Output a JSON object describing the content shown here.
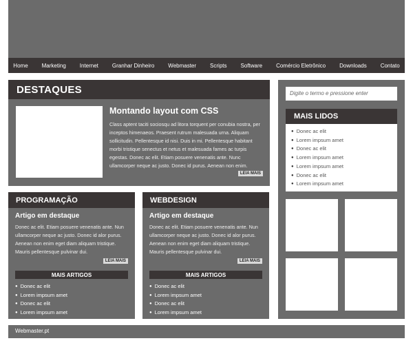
{
  "nav": [
    "Home",
    "Marketing",
    "Internet",
    "Granhar Dinheiro",
    "Webmaster",
    "Scripts",
    "Software",
    "Comércio Eletrônico",
    "Downloads",
    "Contato"
  ],
  "destaques": {
    "heading": "DESTAQUES",
    "title": "Montando layout com CSS",
    "text": "Class aptent taciti sociosqu ad litora torquent per conubia nostra, per inceptos himenaeos. Praesent rutrum malesuada urna. Aliquam sollicitudin. Pellentesque id nisi. Duis in mi. Pellentesque habitant morbi tristique senectus et netus et malesuada fames ac turpis egestas. Donec ac elit. Etiam posuere venenatis ante. Nunc ullamcorper neque ac justo. Donec id purus. Aenean non enim.",
    "button": "LEIA MAIS"
  },
  "programacao": {
    "heading": "PROGRAMAÇÃO",
    "subtitle": "Artigo em destaque",
    "text": "Donec ac elit. Etiam posuere venenatis ante. Nun ullamcorper neque ac justo. Donec id alor purus. Aenean non enim eget diam aliquam tristique. Mauris pellentesque pulvinar dui.",
    "button": "LEIA MAIS",
    "articles_heading": "MAIS ARTIGOS",
    "articles": [
      "Donec ac elit",
      "Lorem impsum amet",
      "Donec ac elit",
      "Lorem impsum amet"
    ]
  },
  "webdesign": {
    "heading": "WEBDESIGN",
    "subtitle": "Artigo em destaque",
    "text": "Donec ac elit. Etiam posuere venenatis ante. Nun ullamcorper neque ac justo. Donec id alor purus. Aenean non enim eget diam aliquam tristique. Mauris pellentesque pulvinar dui.",
    "button": "LEIA MAIS",
    "articles_heading": "MAIS ARTIGOS",
    "articles": [
      "Donec ac elit",
      "Lorem impsum amet",
      "Donec ac elit",
      "Lorem impsum amet"
    ]
  },
  "sidebar": {
    "search_placeholder": "Digite o termo e pressione enter",
    "mais_lidos_heading": "MAIS LIDOS",
    "mais_lidos": [
      "Donec ac elit",
      "Lorem impsum amet",
      "Donec ac elit",
      "Lorem impsum amet",
      "Lorem impsum amet",
      "Donec ac elit",
      "Lorem impsum amet"
    ]
  },
  "footer": "Webmaster.pt"
}
